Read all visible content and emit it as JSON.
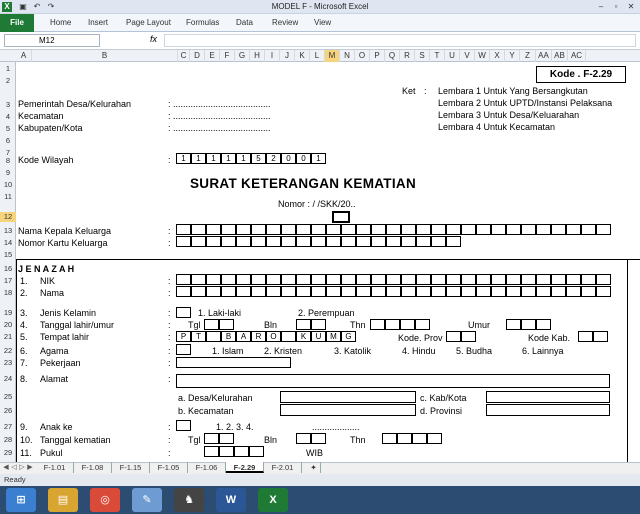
{
  "window": {
    "title": "MODEL F  -  Microsoft Excel",
    "app_icon": "X"
  },
  "ribbon": {
    "file_label": "File",
    "tabs": [
      "Home",
      "Insert",
      "Page Layout",
      "Formulas",
      "Data",
      "Review",
      "View"
    ]
  },
  "formula_bar": {
    "name_box": "M12",
    "fx": "fx",
    "value": ""
  },
  "columns": [
    "A",
    "B",
    "C",
    "D",
    "E",
    "F",
    "G",
    "H",
    "I",
    "J",
    "K",
    "L",
    "M",
    "N",
    "O",
    "P",
    "Q",
    "R",
    "S",
    "T",
    "U",
    "V",
    "W",
    "X",
    "Y",
    "Z",
    "AA",
    "AB",
    "AC"
  ],
  "selected_column": "M",
  "rows": [
    "1",
    "2",
    "3",
    "4",
    "5",
    "6",
    "7",
    "8",
    "9",
    "10",
    "11",
    "12",
    "13",
    "14",
    "15",
    "16",
    "17",
    "18",
    "19",
    "20",
    "21",
    "22",
    "23",
    "24",
    "25",
    "26",
    "27",
    "28",
    "29"
  ],
  "selected_row": "12",
  "form": {
    "kode": "Kode . F-2.29",
    "ket_label": "Ket",
    "colon": ":",
    "ket_lines": [
      "Lembara 1 Untuk Yang Bersangkutan",
      "Lembara 2 Untuk UPTD/Instansi Pelaksana",
      "Lembara 3 Untuk Desa/Keluarahan",
      "Lembara 4 Untuk Kecamatan"
    ],
    "header_labels": [
      "Pemerintah Desa/Kelurahan",
      "Kecamatan",
      "Kabupaten/Kota"
    ],
    "dots": ":  .......................................",
    "kode_wilayah_label": "Kode Wilayah",
    "kode_wilayah_digits": [
      "1",
      "1",
      "1",
      "1",
      "1",
      "5",
      "2",
      "0",
      "0",
      "1"
    ],
    "title": "SURAT KETERANGAN KEMATIAN",
    "nomor": "Nomor :        /         /SKK/20..",
    "kepala_label": "Nama Kepala Keluarga",
    "kk_label": "Nomor Kartu Keluarga",
    "jenazah": "J E N A Z A H",
    "items": [
      {
        "no": "1.",
        "label": "NIK"
      },
      {
        "no": "2.",
        "label": "Nama"
      },
      {
        "no": "3.",
        "label": "Jenis Kelamin"
      },
      {
        "no": "4.",
        "label": "Tanggal lahir/umur"
      },
      {
        "no": "5.",
        "label": "Tempat lahir"
      },
      {
        "no": "6.",
        "label": "Agama"
      },
      {
        "no": "7.",
        "label": "Pekerjaan"
      },
      {
        "no": "8.",
        "label": "Alamat"
      },
      {
        "no": "9.",
        "label": "Anak ke"
      },
      {
        "no": "10.",
        "label": "Tanggal kematian"
      },
      {
        "no": "11.",
        "label": "Pukul"
      }
    ],
    "jk_opt1": "1. Laki-laki",
    "jk_opt2": "2. Perempuan",
    "tgl": "Tgl",
    "bln": "Bln",
    "thn": "Thn",
    "umur": "Umur",
    "tempat_letters": [
      "P",
      "T",
      "",
      "B",
      "A",
      "R",
      "O",
      "",
      "K",
      "U",
      "M",
      "G"
    ],
    "kode_prov": "Kode. Prov",
    "kode_kab": "Kode Kab.",
    "agama_opts": [
      "1. Islam",
      "2. Kristen",
      "3. Katolik",
      "4. Hindu",
      "5. Budha",
      "6. Lainnya"
    ],
    "alamat_a": "a.  Desa/Kelurahan",
    "alamat_b": "b.  Kecamatan",
    "alamat_c": "c.  Kab/Kota",
    "alamat_d": "d.  Provinsi",
    "anak_opts": "1.  2.  3.  4.",
    "anak_dots": "...................",
    "wib": "WIB"
  },
  "sheet_tabs": [
    "F-1.01",
    "F-1.08",
    "F-1.15",
    "F-1.05",
    "F-1.06",
    "F-2.29",
    "F-2.01"
  ],
  "active_sheet": "F-2.29",
  "status_bar": {
    "text": "Ready"
  },
  "taskbar": {
    "apps": [
      {
        "name": "windows-start-icon",
        "glyph": "⊞",
        "color": "#3b7fd1"
      },
      {
        "name": "file-explorer-icon",
        "glyph": "▤",
        "color": "#d9a531"
      },
      {
        "name": "chrome-icon",
        "glyph": "◎",
        "color": "#d94a38"
      },
      {
        "name": "paint-icon",
        "glyph": "✎",
        "color": "#6e9bd1"
      },
      {
        "name": "game-icon",
        "glyph": "♞",
        "color": "#444444"
      },
      {
        "name": "word-icon",
        "glyph": "W",
        "color": "#2b5797"
      },
      {
        "name": "excel-icon",
        "glyph": "X",
        "color": "#1f7a36"
      }
    ]
  },
  "colors": {
    "selection": "#f6d47b",
    "file_tab": "#1f7a36",
    "taskbar": "#2d4c71"
  }
}
